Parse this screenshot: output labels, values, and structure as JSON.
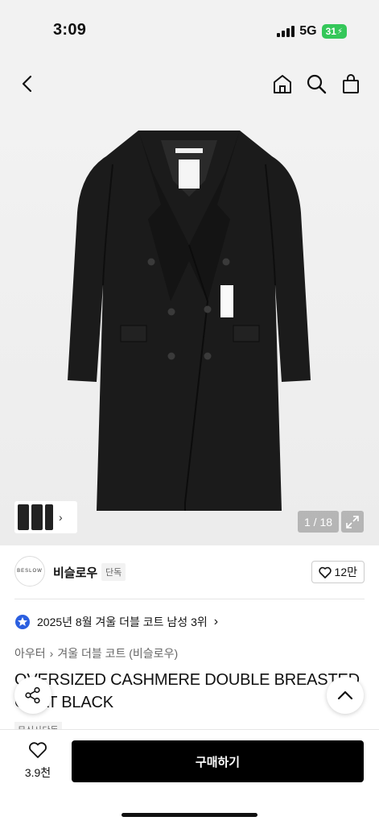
{
  "status": {
    "time": "3:09",
    "network": "5G",
    "battery": "31"
  },
  "nav": {
    "back_icon": "chevron-left-icon",
    "home_icon": "home-icon",
    "search_icon": "search-icon",
    "bag_icon": "shopping-bag-icon"
  },
  "gallery": {
    "pager": "1 / 18",
    "label_text": "BESLOW"
  },
  "brand": {
    "logo_text": "BESLOW",
    "name": "비슬로우",
    "tag": "단독",
    "likes": "12만"
  },
  "ranking": {
    "text": "2025년 8월 겨울 더블 코트 남성 3위"
  },
  "breadcrumb": {
    "level1": "아우터",
    "level2": "겨울 더블 코트 (비슬로우)"
  },
  "product": {
    "title": "OVERSIZED CASHMERE DOUBLE BREASTED COAT BLACK",
    "tag": "무신사단독"
  },
  "bottom": {
    "wish_count": "3.9천",
    "buy_label": "구매하기"
  },
  "colors": {
    "accent": "#000000",
    "battery": "#34c759",
    "rank_badge": "#2b5fe0"
  }
}
